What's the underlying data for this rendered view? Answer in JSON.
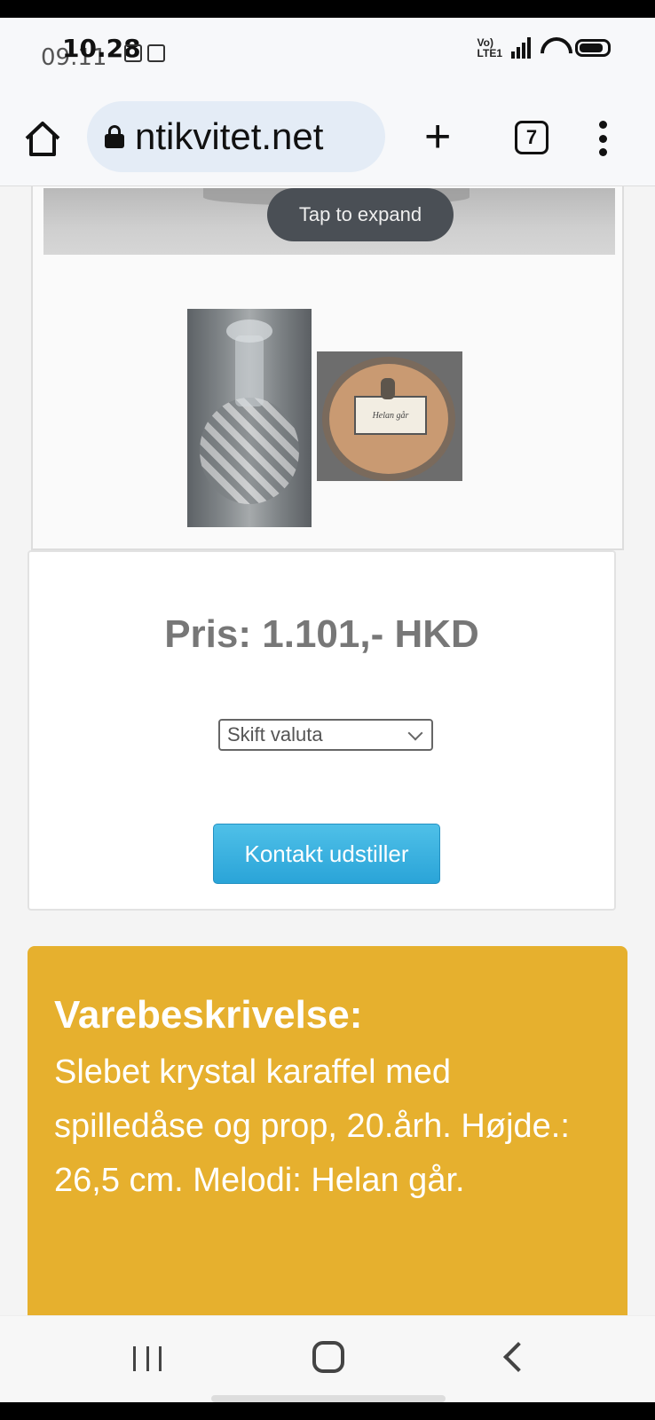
{
  "status_bar": {
    "time_faded": "09.11",
    "time": "10.28"
  },
  "browser": {
    "url": "ntikvitet.net",
    "tab_count": "7",
    "plus_label": "+"
  },
  "gallery": {
    "tap_to_expand": "Tap to expand",
    "music_box_label": "Helan går"
  },
  "price_box": {
    "price": "Pris: 1.101,- HKD",
    "currency_select": "Skift valuta",
    "contact_button": "Kontakt udstiller"
  },
  "description": {
    "title": "Varebeskrivelse:",
    "text": "Slebet krystal karaffel med spilledåse og prop, 20.årh. Højde.: 26,5 cm. Melodi: Helan går."
  }
}
